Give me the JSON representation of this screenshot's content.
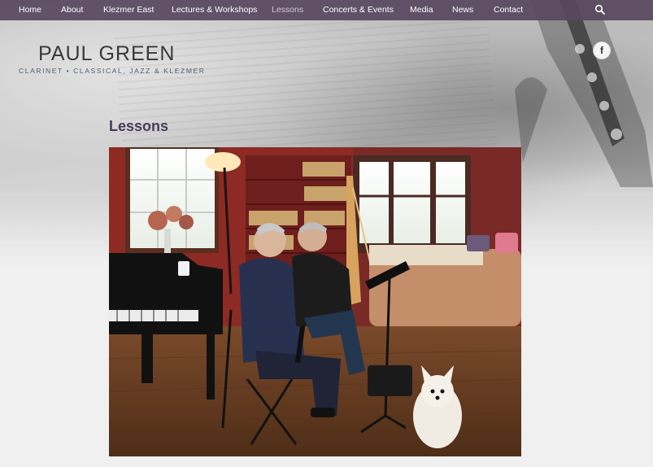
{
  "nav": {
    "items": [
      {
        "label": "Home",
        "active": false
      },
      {
        "label": "About",
        "active": false
      },
      {
        "label": "Klezmer East",
        "active": false
      },
      {
        "label": "Lectures & Workshops",
        "active": false
      },
      {
        "label": "Lessons",
        "active": true
      },
      {
        "label": "Concerts & Events",
        "active": false
      },
      {
        "label": "Media",
        "active": false
      },
      {
        "label": "News",
        "active": false
      },
      {
        "label": "Contact",
        "active": false
      }
    ],
    "search_icon": "search-icon"
  },
  "site": {
    "title": "PAUL GREEN",
    "tagline": "CLARINET • CLASSICAL, JAZZ & KLEZMER"
  },
  "social": {
    "facebook_icon": "facebook-icon",
    "facebook_glyph": "f"
  },
  "page": {
    "title": "Lessons"
  },
  "colors": {
    "nav_bg": "#584860",
    "nav_text": "#ffffff",
    "nav_active": "#cfc6d6",
    "title_text": "#3a3a3a",
    "tagline_text": "#4b5f7a",
    "page_title": "#4a3c5a",
    "page_bg": "#f0f0f0"
  }
}
